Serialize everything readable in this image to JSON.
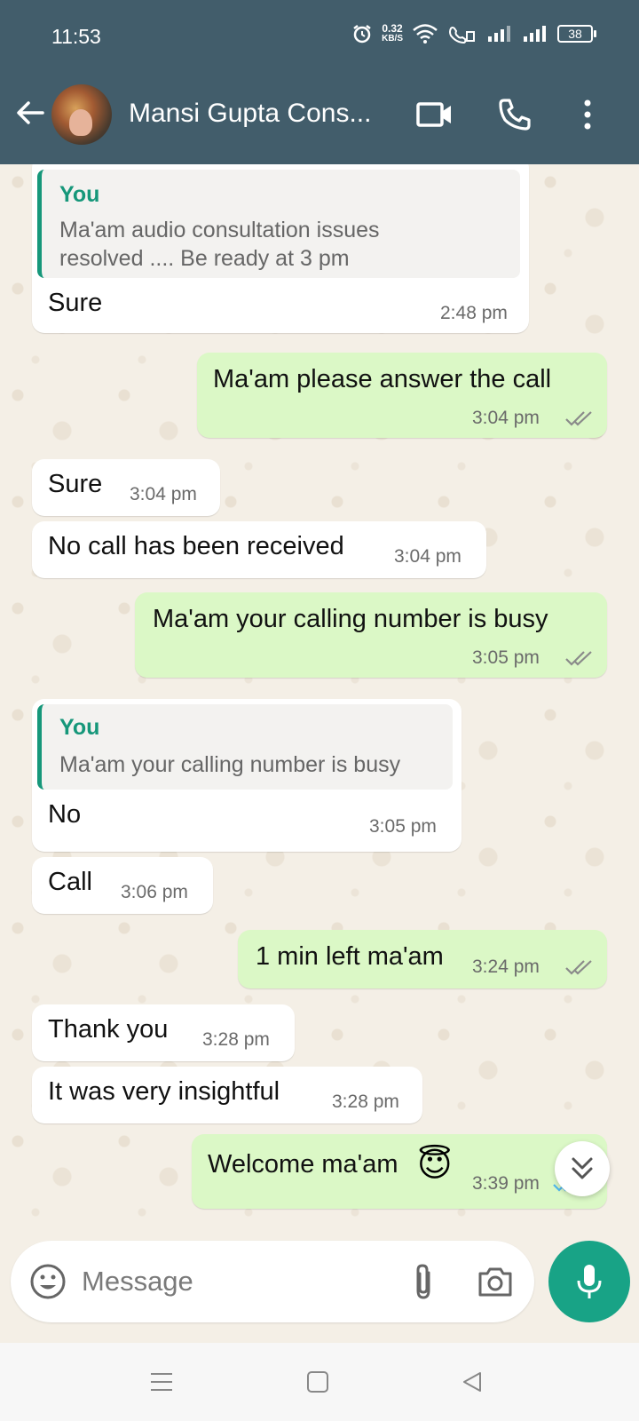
{
  "status_bar": {
    "time": "11:53",
    "net_speed_value": "0.32",
    "net_speed_unit": "KB/S",
    "battery": "38"
  },
  "header": {
    "contact_name": "Mansi Gupta Cons..."
  },
  "messages": [
    {
      "dir": "in",
      "quote_author": "You",
      "quote_line1": "Ma'am audio consultation issues",
      "quote_line2": "resolved .... Be ready at 3 pm",
      "text": "Sure",
      "time": "2:48 pm"
    },
    {
      "dir": "out",
      "text": "Ma'am please answer the call",
      "time": "3:04 pm"
    },
    {
      "dir": "in",
      "text": "Sure",
      "time": "3:04 pm"
    },
    {
      "dir": "in",
      "text": "No call has been received",
      "time": "3:04 pm"
    },
    {
      "dir": "out",
      "text": "Ma'am your calling number is busy",
      "time": "3:05 pm"
    },
    {
      "dir": "in",
      "quote_author": "You",
      "quote_line1": "Ma'am your calling number is busy",
      "text": "No",
      "time": "3:05 pm"
    },
    {
      "dir": "in",
      "text": "Call",
      "time": "3:06 pm"
    },
    {
      "dir": "out",
      "text": "1 min left ma'am",
      "time": "3:24 pm"
    },
    {
      "dir": "in",
      "text": "Thank you",
      "time": "3:28 pm"
    },
    {
      "dir": "in",
      "text": "It was very insightful",
      "time": "3:28 pm"
    },
    {
      "dir": "out",
      "text": "Welcome ma'am",
      "emoji": "😇",
      "time": "3:39 pm"
    }
  ],
  "composer": {
    "placeholder": "Message"
  },
  "colors": {
    "header": "#425d6b",
    "outgoing_bubble": "#dbf8c6",
    "incoming_bubble": "#ffffff",
    "accent": "#18a386",
    "read_ticks": "#8a8a8a",
    "chat_background": "#f4efe6"
  },
  "icons": {
    "back": "back-arrow-icon",
    "video_call": "video-camera-icon",
    "voice_call": "phone-icon",
    "menu": "more-vertical-icon",
    "emoji": "emoji-icon",
    "attach": "paperclip-icon",
    "camera": "camera-icon",
    "mic": "microphone-icon",
    "scroll_down": "double-chevron-down-icon"
  }
}
